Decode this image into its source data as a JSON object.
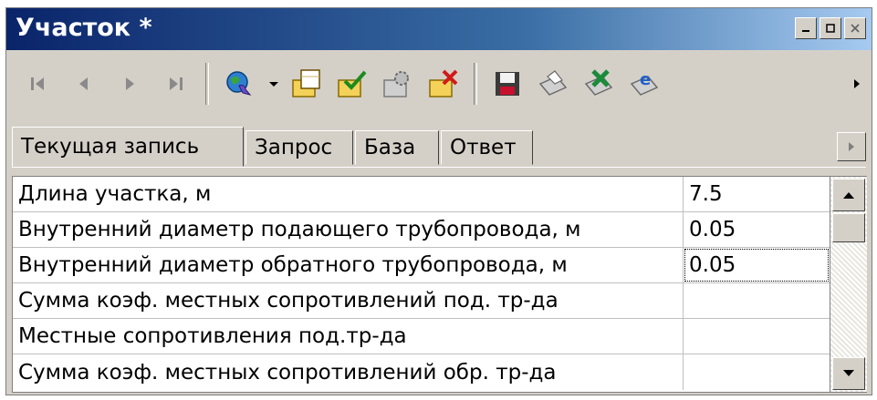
{
  "window": {
    "title": "Участок *"
  },
  "toolbar": {
    "navigation": [
      "first-record-icon",
      "prev-record-icon",
      "next-record-icon",
      "last-record-icon"
    ],
    "actions": [
      "globe-icon",
      "dropdown-arrow-icon",
      "new-record-icon",
      "apply-icon",
      "settings-icon",
      "delete-icon"
    ],
    "file_actions": [
      "save-icon",
      "print-icon",
      "excel-icon",
      "browser-icon"
    ]
  },
  "tabs": [
    {
      "label": "Текущая запись",
      "active": true
    },
    {
      "label": "Запрос",
      "active": false
    },
    {
      "label": "База",
      "active": false
    },
    {
      "label": "Ответ",
      "active": false
    }
  ],
  "grid": {
    "rows": [
      {
        "label": "Длина участка, м",
        "value": "7.5"
      },
      {
        "label": "Внутренний диаметр подающего трубопровода, м",
        "value": "0.05"
      },
      {
        "label": "Внутренний диаметр обратного трубопровода, м",
        "value": "0.05"
      },
      {
        "label": "Сумма коэф. местных сопротивлений под. тр-да",
        "value": ""
      },
      {
        "label": "Местные сопротивления под.тр-да",
        "value": ""
      },
      {
        "label": "Сумма коэф. местных сопротивлений обр. тр-да",
        "value": ""
      }
    ]
  },
  "colors": {
    "title_gradient_start": "#0a246a",
    "title_gradient_end": "#a6caf0",
    "chrome": "#d4d0c8"
  }
}
